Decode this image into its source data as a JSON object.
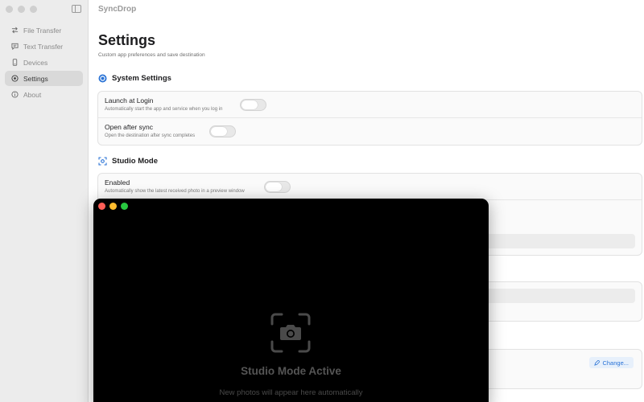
{
  "app": {
    "title": "SyncDrop"
  },
  "sidebar": {
    "items": [
      {
        "label": "File Transfer",
        "icon": "arrows-swap-icon"
      },
      {
        "label": "Text Transfer",
        "icon": "message-icon"
      },
      {
        "label": "Devices",
        "icon": "phone-icon"
      },
      {
        "label": "Settings",
        "icon": "gear-icon",
        "active": true
      },
      {
        "label": "About",
        "icon": "info-icon"
      }
    ]
  },
  "page": {
    "title": "Settings",
    "subtitle": "Custom app preferences and save destination"
  },
  "system_settings": {
    "header": "System Settings",
    "rows": [
      {
        "title": "Launch at Login",
        "desc": "Automatically start the app and service when you log in",
        "toggle": false
      },
      {
        "title": "Open after sync",
        "desc": "Open the destination after sync completes",
        "toggle": false
      }
    ]
  },
  "studio_mode": {
    "header": "Studio Mode",
    "enabled_title": "Enabled",
    "enabled_desc": "Automatically show the latest received photo in a preview window",
    "enabled_toggle": false
  },
  "save_destination": {
    "change_label": "Change..."
  },
  "studio_window": {
    "title": "Studio Mode Active",
    "subtitle": "New photos will appear here automatically",
    "traffic_colors": [
      "#ff5f57",
      "#febc2e",
      "#28c840"
    ]
  },
  "colors": {
    "accent": "#2a73d6",
    "sidebar_bg": "#ececec"
  }
}
